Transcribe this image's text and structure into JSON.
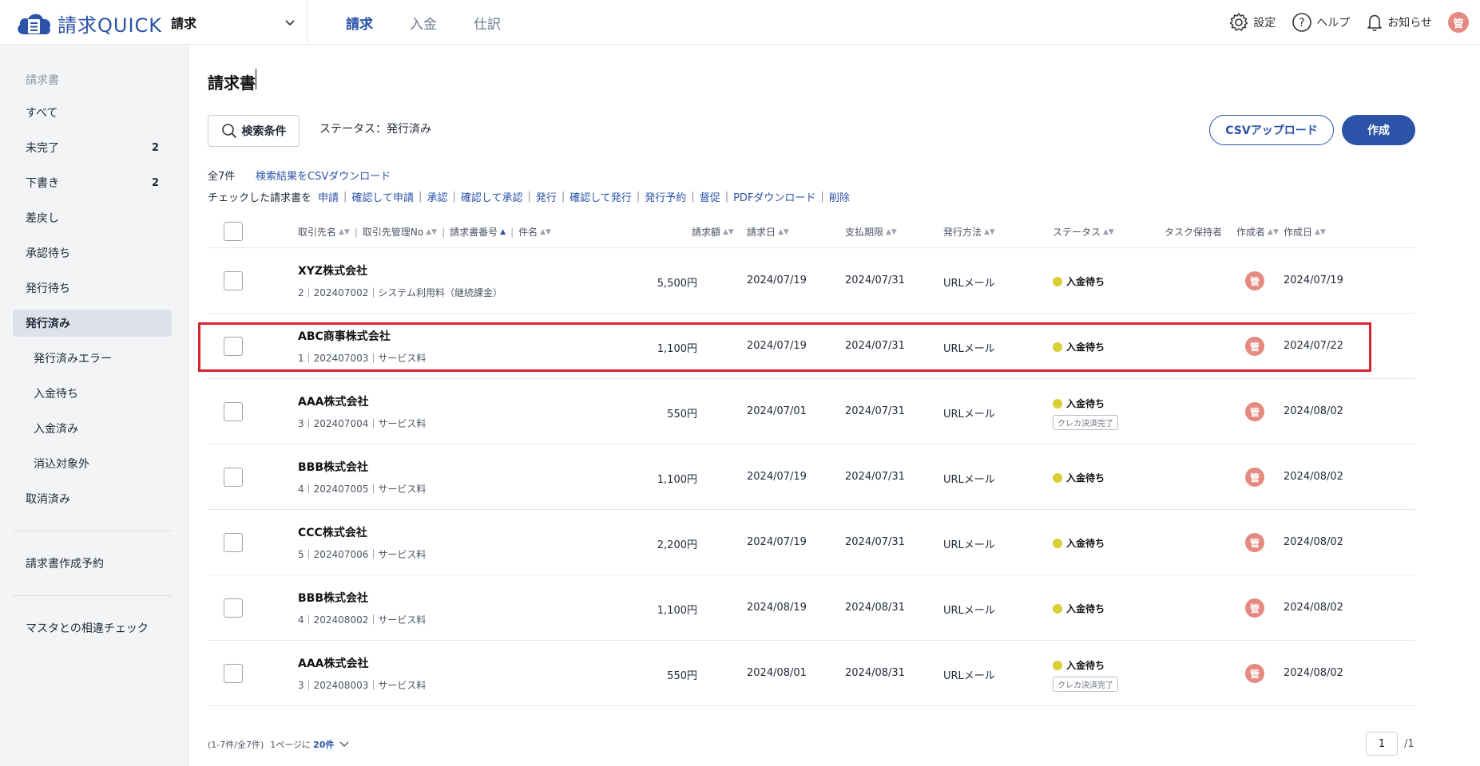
{
  "app": {
    "logo_text": "請求QUICK",
    "selected_app": "請求"
  },
  "topnav": [
    {
      "label": "請求",
      "active": true
    },
    {
      "label": "入金",
      "active": false
    },
    {
      "label": "仕訳",
      "active": false
    }
  ],
  "header_right": {
    "settings": "設定",
    "help": "ヘルプ",
    "notices": "お知らせ",
    "avatar": "管"
  },
  "sidebar": {
    "heading": "請求書",
    "items": [
      {
        "label": "すべて",
        "count": ""
      },
      {
        "label": "未完了",
        "count": "2"
      },
      {
        "label": "下書き",
        "count": "2"
      },
      {
        "label": "差戻し",
        "count": ""
      },
      {
        "label": "承認待ち",
        "count": ""
      },
      {
        "label": "発行待ち",
        "count": ""
      },
      {
        "label": "発行済み",
        "count": "",
        "active": true
      },
      {
        "label": "発行済みエラー",
        "count": ""
      },
      {
        "label": "入金待ち",
        "count": ""
      },
      {
        "label": "入金済み",
        "count": ""
      },
      {
        "label": "消込対象外",
        "count": ""
      },
      {
        "label": "取消済み",
        "count": ""
      }
    ],
    "extra": [
      "請求書作成予約",
      "マスタとの相違チェック"
    ]
  },
  "main": {
    "title": "請求書",
    "search_button": "検索条件",
    "status_filter": "ステータス：発行済み",
    "csv_upload": "CSVアップロード",
    "create": "作成",
    "total": "全7件",
    "csv_download": "検索結果をCSVダウンロード",
    "bulk_label": "チェックした請求書を",
    "bulk_actions": [
      "申請",
      "確認して申請",
      "承認",
      "確認して承認",
      "発行",
      "確認して発行",
      "発行予約",
      "督促",
      "PDFダウンロード",
      "削除"
    ]
  },
  "table": {
    "headers": {
      "client": "取引先名",
      "client_no": "取引先管理No",
      "invoice_no": "請求書番号",
      "subject": "件名",
      "amount": "請求額",
      "invoice_date": "請求日",
      "due_date": "支払期限",
      "method": "発行方法",
      "status": "ステータス",
      "task_holder": "タスク保持者",
      "creator": "作成者",
      "created_date": "作成日"
    },
    "rows": [
      {
        "client": "XYZ株式会社",
        "sub": "2｜202407002｜システム利用料（継続課金）",
        "amount": "5,500円",
        "invoice_date": "2024/07/19",
        "due_date": "2024/07/31",
        "method": "URLメール",
        "status": "入金待ち",
        "badge": "",
        "creator": "管",
        "created": "2024/07/19"
      },
      {
        "client": "ABC商事株式会社",
        "sub": "1｜202407003｜サービス料",
        "amount": "1,100円",
        "invoice_date": "2024/07/19",
        "due_date": "2024/07/31",
        "method": "URLメール",
        "status": "入金待ち",
        "badge": "",
        "creator": "管",
        "created": "2024/07/22"
      },
      {
        "client": "AAA株式会社",
        "sub": "3｜202407004｜サービス料",
        "amount": "550円",
        "invoice_date": "2024/07/01",
        "due_date": "2024/07/31",
        "method": "URLメール",
        "status": "入金待ち",
        "badge": "クレカ決済完了",
        "creator": "管",
        "created": "2024/08/02"
      },
      {
        "client": "BBB株式会社",
        "sub": "4｜202407005｜サービス料",
        "amount": "1,100円",
        "invoice_date": "2024/07/19",
        "due_date": "2024/07/31",
        "method": "URLメール",
        "status": "入金待ち",
        "badge": "",
        "creator": "管",
        "created": "2024/08/02"
      },
      {
        "client": "CCC株式会社",
        "sub": "5｜202407006｜サービス料",
        "amount": "2,200円",
        "invoice_date": "2024/07/19",
        "due_date": "2024/07/31",
        "method": "URLメール",
        "status": "入金待ち",
        "badge": "",
        "creator": "管",
        "created": "2024/08/02"
      },
      {
        "client": "BBB株式会社",
        "sub": "4｜202408002｜サービス料",
        "amount": "1,100円",
        "invoice_date": "2024/08/19",
        "due_date": "2024/08/31",
        "method": "URLメール",
        "status": "入金待ち",
        "badge": "",
        "creator": "管",
        "created": "2024/08/02"
      },
      {
        "client": "AAA株式会社",
        "sub": "3｜202408003｜サービス料",
        "amount": "550円",
        "invoice_date": "2024/08/01",
        "due_date": "2024/08/31",
        "method": "URLメール",
        "status": "入金待ち",
        "badge": "クレカ決済完了",
        "creator": "管",
        "created": "2024/08/02"
      }
    ]
  },
  "footer": {
    "range": "(1-7件/全7件)",
    "per_page_label": "1ページに",
    "per_page_value": "20件",
    "page": "1",
    "page_total": "/1"
  },
  "colors": {
    "accent": "#2b53a7",
    "status_dot": "#d9cf35",
    "avatar": "#e58a80",
    "highlight": "#d9232e"
  }
}
